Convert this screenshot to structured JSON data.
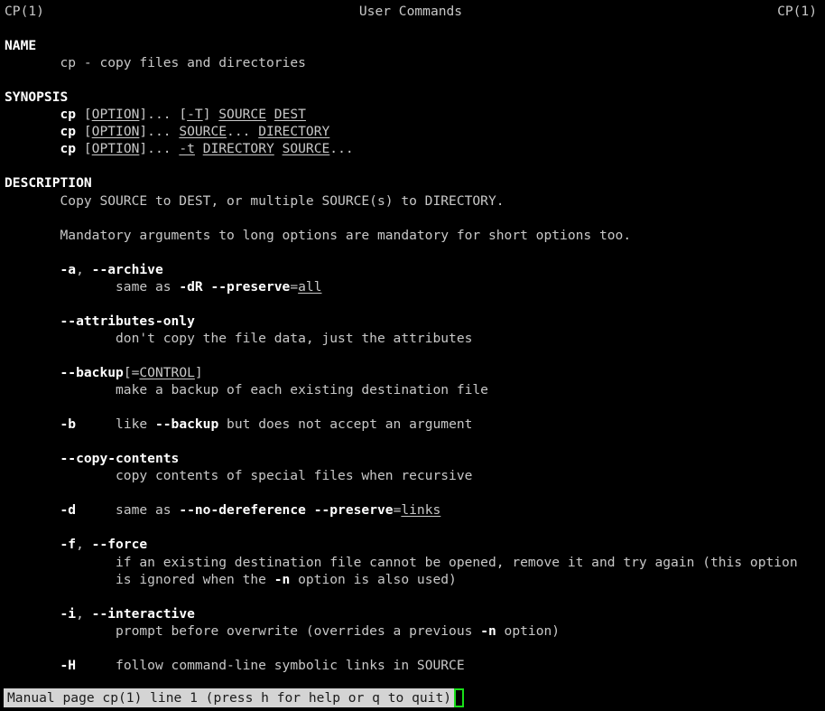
{
  "terminal": {
    "background_color": "#000000",
    "foreground_color": "#c8c8c8",
    "bold_color": "#ffffff",
    "cursor_color": "#19e019",
    "status_bg_color": "#d4d4d4",
    "status_fg_color": "#1a1a1a"
  },
  "manpage": {
    "header": {
      "left": "CP(1)",
      "center": "User Commands",
      "right": "CP(1)"
    },
    "sections": {
      "name": {
        "heading": "NAME",
        "body": "cp - copy files and directories"
      },
      "synopsis": {
        "heading": "SYNOPSIS",
        "lines": [
          {
            "cmd": "cp",
            "option": "OPTION",
            "rest1": "[-T]",
            "args": "SOURCE DEST"
          },
          {
            "cmd": "cp",
            "option": "OPTION",
            "args": "SOURCE... DIRECTORY"
          },
          {
            "cmd": "cp",
            "option": "OPTION",
            "flag": "-t",
            "args": "DIRECTORY SOURCE..."
          }
        ]
      },
      "description": {
        "heading": "DESCRIPTION",
        "intro": "Copy SOURCE to DEST, or multiple SOURCE(s) to DIRECTORY.",
        "mandatory_note": "Mandatory arguments to long options are mandatory for short options too.",
        "options": [
          {
            "id": "archive",
            "term_short": "-a",
            "term_long": "--archive",
            "desc_prefix": "same as ",
            "desc_bold1": "-dR --preserve",
            "desc_eq": "=",
            "desc_underline": "all"
          },
          {
            "id": "attributes-only",
            "term_long": "--attributes-only",
            "desc": "don't copy the file data, just the attributes"
          },
          {
            "id": "backup",
            "term_long": "--backup",
            "term_suffix_open": "[=",
            "term_underline": "CONTROL",
            "term_suffix_close": "]",
            "desc": "make a backup of each existing destination file"
          },
          {
            "id": "b",
            "term_short": "-b",
            "desc_prefix": "like ",
            "desc_bold1": "--backup",
            "desc_suffix": " but does not accept an argument"
          },
          {
            "id": "copy-contents",
            "term_long": "--copy-contents",
            "desc": "copy contents of special files when recursive"
          },
          {
            "id": "d",
            "term_short": "-d",
            "desc_prefix": "same as ",
            "desc_bold1": "--no-dereference --preserve",
            "desc_eq": "=",
            "desc_underline": "links"
          },
          {
            "id": "force",
            "term_short": "-f",
            "term_long": "--force",
            "desc_line1": "if an existing destination file cannot be opened, remove it and try again (this option",
            "desc_line2_prefix": "is ignored when the ",
            "desc_line2_bold": "-n",
            "desc_line2_suffix": " option is also used)"
          },
          {
            "id": "interactive",
            "term_short": "-i",
            "term_long": "--interactive",
            "desc_prefix": "prompt before overwrite (overrides a previous ",
            "desc_bold1": "-n",
            "desc_suffix": " option)"
          },
          {
            "id": "H",
            "term_short": "-H",
            "desc": "follow command-line symbolic links in SOURCE"
          }
        ]
      }
    }
  },
  "status": {
    "text": "Manual page cp(1) line 1 (press h for help or q to quit)"
  }
}
